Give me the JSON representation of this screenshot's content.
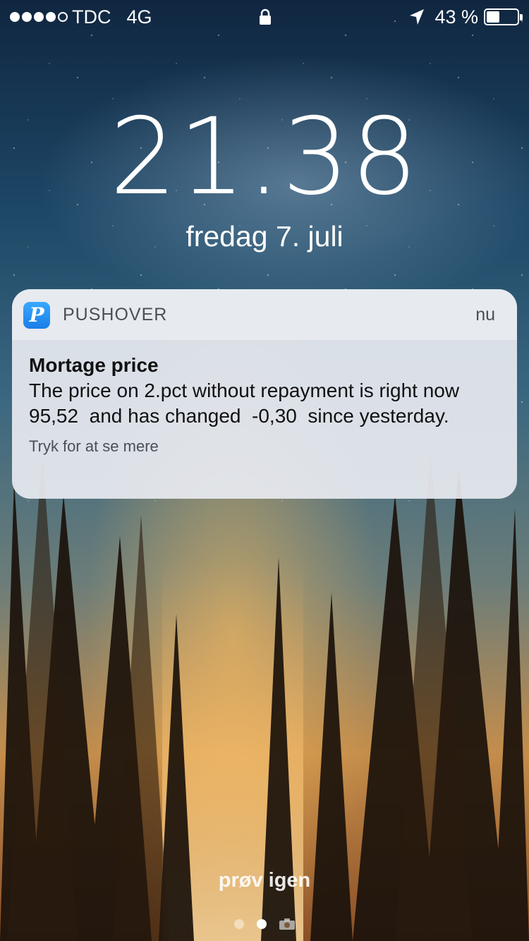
{
  "status_bar": {
    "signal_bars_filled": 4,
    "signal_bars_total": 5,
    "carrier": "TDC",
    "network": "4G",
    "battery_text": "43 %",
    "battery_level": 0.43
  },
  "lockscreen": {
    "time": "21.38",
    "date": "fredag 7. juli",
    "bottom_text": "prøv igen",
    "page_dots": 2,
    "active_page": 1
  },
  "notification": {
    "app_icon_letter": "P",
    "app_name": "PUSHOVER",
    "time": "nu",
    "title": "Mortage price",
    "message": "The price on 2.pct without repayment is right now  95,52  and has changed  -0,30  since yesterday.",
    "hint": "Tryk for at se mere"
  },
  "colors": {
    "notification_bg": "#e7eaf0",
    "app_icon": "#1a7ee6"
  }
}
